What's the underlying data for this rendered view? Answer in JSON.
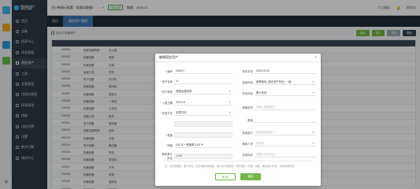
{
  "dock": {
    "colors": [
      "#3fb6e6",
      "#f5a623",
      "#2f9cdb",
      "#6cbf4c"
    ]
  },
  "sidebar": {
    "brand_line1": "畅捷通好会计",
    "brand_line2": "财务云服务",
    "items": [
      {
        "label": "首页"
      },
      {
        "label": "总账"
      },
      {
        "label": "报表中心"
      },
      {
        "label": "资金管理"
      },
      {
        "label": "固定资产"
      },
      {
        "label": "工资"
      },
      {
        "label": "发票管理"
      },
      {
        "label": "进销存管理"
      },
      {
        "label": "报表管理"
      },
      {
        "label": "结账"
      },
      {
        "label": "初始设置"
      },
      {
        "label": "设置"
      },
      {
        "label": "数字引擎"
      },
      {
        "label": "税务中心"
      }
    ]
  },
  "topbar": {
    "doc_tab": "百小畅演示账套（非真实数据）",
    "status_chip": "已建空账",
    "period": "账期：2023-12",
    "service": "人工服务",
    "user": "欧阳丰"
  },
  "subnav": {
    "crumb": "首页",
    "active_tab": "固定资产管理"
  },
  "toolbar": {
    "filter_label": "显示已处置资产",
    "buttons": [
      "新增",
      "导入",
      "导出",
      "更多"
    ]
  },
  "table": {
    "rows": [
      {
        "no": "000001",
        "cat": "房屋及建筑物",
        "name": "办公楼"
      },
      {
        "no": "000002",
        "cat": "机器设备",
        "name": "电脑"
      },
      {
        "no": "000003",
        "cat": "机器设备",
        "name": "空调"
      },
      {
        "no": "000004",
        "cat": "运输工具",
        "name": "货车"
      },
      {
        "no": "000005",
        "cat": "电子设备",
        "name": "打印机"
      },
      {
        "no": "000006",
        "cat": "机器设备",
        "name": "复印机"
      },
      {
        "no": "000007",
        "cat": "机器设备",
        "name": "投影仪"
      },
      {
        "no": "000008",
        "cat": "机器设备",
        "name": "一体机"
      },
      {
        "no": "000009",
        "cat": "机器设备",
        "name": "工作站"
      },
      {
        "no": "000010",
        "cat": "运输工具",
        "name": "轿车"
      },
      {
        "no": "000011",
        "cat": "电子设备",
        "name": "服务器"
      },
      {
        "no": "000012",
        "cat": "房屋及建筑物",
        "name": "仓库"
      },
      {
        "no": "000013",
        "cat": "机器设备",
        "name": "冷柜"
      },
      {
        "no": "000014",
        "cat": "电子设备",
        "name": "路由器"
      },
      {
        "no": "000015",
        "cat": "机器设备",
        "name": "货架"
      },
      {
        "no": "000016",
        "cat": "机器设备",
        "name": "发电机"
      },
      {
        "no": "000017",
        "cat": "机器设备",
        "name": "叉车"
      },
      {
        "no": "000018",
        "cat": "机器设备",
        "name": "电梯"
      },
      {
        "no": "000019",
        "cat": "机器设备",
        "name": "装卸机"
      },
      {
        "no": "000020",
        "cat": "机器设备",
        "name": "保险柜"
      }
    ]
  },
  "modal": {
    "title": "编辑固定资产",
    "left_fields": [
      {
        "label": "编号",
        "value": "000007",
        "required": true,
        "disabled": false,
        "arrow": false
      },
      {
        "label": "资产名称",
        "value": "11",
        "required": true,
        "disabled": false,
        "arrow": false
      },
      {
        "label": "资产类别",
        "value": "房屋及建筑物",
        "required": true,
        "disabled": false,
        "arrow": true
      },
      {
        "label": "入账日期",
        "value": "2023-01",
        "required": true,
        "disabled": false,
        "arrow": true
      },
      {
        "label": "折旧方法",
        "value": "年限平均",
        "required": true,
        "disabled": false,
        "arrow": true
      },
      {
        "label": "",
        "value": "",
        "required": false,
        "disabled": true,
        "arrow": false
      },
      {
        "label": "原值",
        "value": "",
        "required": true,
        "disabled": true,
        "arrow": false
      },
      {
        "label": "残值",
        "value": "240    天  * 残值率    5.00   %",
        "required": true,
        "disabled": false,
        "arrow": false
      },
      {
        "label": "期初累计折旧",
        "value": "0.00",
        "required": false,
        "disabled": true,
        "arrow": false
      }
    ],
    "right_fields": [
      {
        "label": "本年折旧",
        "value": "0000.00.33",
        "placeholder": "",
        "arrow": false
      },
      {
        "label": "费用科目",
        "value": "管理费用_固定资产折旧_一级",
        "placeholder": "",
        "arrow": true
      },
      {
        "label": "折旧科目",
        "value": "累计折旧",
        "placeholder": "",
        "arrow": true
      },
      {
        "label": "规格型号",
        "value": "",
        "placeholder": "请输入规格型号",
        "arrow": false
      },
      {
        "label": "数量",
        "value": "",
        "placeholder": "",
        "arrow": false
      },
      {
        "label": "使用部门",
        "value": "",
        "placeholder": "请选择使用部门",
        "arrow": true
      },
      {
        "label": "使用人员",
        "value": "",
        "placeholder": "请选择",
        "arrow": true
      },
      {
        "label": "存放地点",
        "value": "",
        "placeholder": "请输入存放地点",
        "arrow": false
      }
    ],
    "note": "注：已折旧期数、累计折旧：已折旧期间的金额，各字段不能修改；月折旧额：（原值 - 残值 - 期初累计折旧）/ 剩余使用月份。",
    "cancel_label": "取消",
    "ok_label": "保存"
  }
}
